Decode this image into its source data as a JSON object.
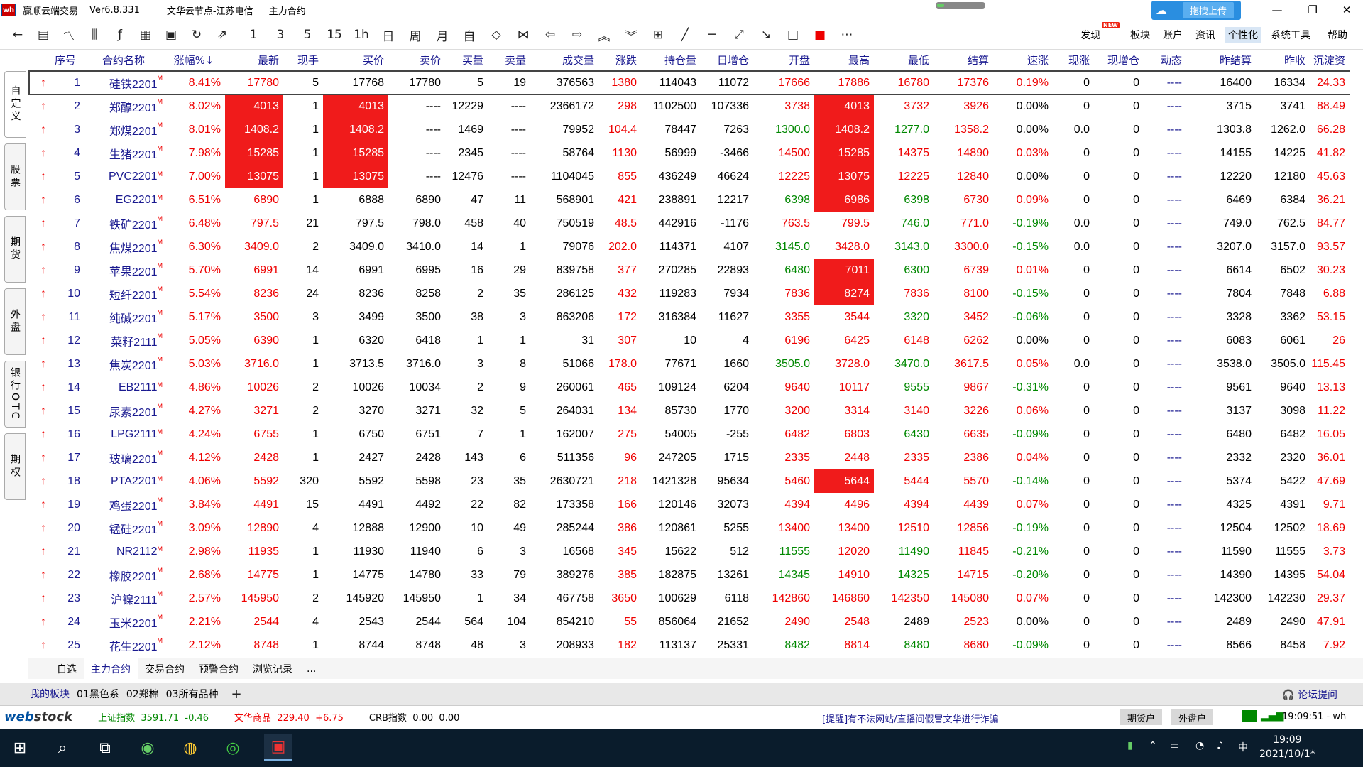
{
  "title": {
    "app": "赢顺云端交易",
    "version": "Ver6.8.331",
    "node": "文华云节点-江苏电信",
    "contract": "主力合约"
  },
  "cloud_upload": "拖拽上传",
  "menu": [
    {
      "label": "发现",
      "new": "NEW"
    },
    {
      "label": "板块"
    },
    {
      "label": "账户"
    },
    {
      "label": "资讯"
    },
    {
      "label": "个性化"
    },
    {
      "label": "系统工具"
    },
    {
      "label": "帮助"
    }
  ],
  "toolbar_periods": [
    "1",
    "3",
    "5",
    "15",
    "1h",
    "日",
    "周",
    "月",
    "自"
  ],
  "side_tabs": [
    "自定义",
    "股票",
    "期货",
    "外盘",
    "银行OTC",
    "期权"
  ],
  "columns": [
    "序号",
    "合约名称",
    "涨幅%↓",
    "最新",
    "现手",
    "买价",
    "卖价",
    "买量",
    "卖量",
    "成交量",
    "涨跌",
    "持仓量",
    "日增仓",
    "开盘",
    "最高",
    "最低",
    "结算",
    "速涨",
    "现涨",
    "现增仓",
    "动态",
    "昨结算",
    "昨收",
    "沉淀资"
  ],
  "rows": [
    [
      "1",
      "硅铁2201",
      "8.41%",
      "17780",
      "5",
      "17768",
      "17780",
      "5",
      "19",
      "376563",
      "1380",
      "114043",
      "11072",
      "17666",
      "17886",
      "16780",
      "17376",
      "0.19%",
      "0",
      "0",
      "----",
      "16400",
      "16334",
      "24.33"
    ],
    [
      "2",
      "郑醇2201",
      "8.02%",
      "4013",
      "1",
      "4013",
      "----",
      "12229",
      "----",
      "2366172",
      "298",
      "1102500",
      "107336",
      "3738",
      "4013",
      "3732",
      "3926",
      "0.00%",
      "0",
      "0",
      "----",
      "3715",
      "3741",
      "88.49"
    ],
    [
      "3",
      "郑煤2201",
      "8.01%",
      "1408.2",
      "1",
      "1408.2",
      "----",
      "1469",
      "----",
      "79952",
      "104.4",
      "78447",
      "7263",
      "1300.0",
      "1408.2",
      "1277.0",
      "1358.2",
      "0.00%",
      "0.0",
      "0",
      "----",
      "1303.8",
      "1262.0",
      "66.28"
    ],
    [
      "4",
      "生猪2201",
      "7.98%",
      "15285",
      "1",
      "15285",
      "----",
      "2345",
      "----",
      "58764",
      "1130",
      "56999",
      "-3466",
      "14500",
      "15285",
      "14375",
      "14890",
      "0.03%",
      "0",
      "0",
      "----",
      "14155",
      "14225",
      "41.82"
    ],
    [
      "5",
      "PVC2201",
      "7.00%",
      "13075",
      "1",
      "13075",
      "----",
      "12476",
      "----",
      "1104045",
      "855",
      "436249",
      "46624",
      "12225",
      "13075",
      "12225",
      "12840",
      "0.00%",
      "0",
      "0",
      "----",
      "12220",
      "12180",
      "45.63"
    ],
    [
      "6",
      "EG2201",
      "6.51%",
      "6890",
      "1",
      "6888",
      "6890",
      "47",
      "11",
      "568901",
      "421",
      "238891",
      "12217",
      "6398",
      "6986",
      "6398",
      "6730",
      "0.09%",
      "0",
      "0",
      "----",
      "6469",
      "6384",
      "36.21"
    ],
    [
      "7",
      "铁矿2201",
      "6.48%",
      "797.5",
      "21",
      "797.5",
      "798.0",
      "458",
      "40",
      "750519",
      "48.5",
      "442916",
      "-1176",
      "763.5",
      "799.5",
      "746.0",
      "771.0",
      "-0.19%",
      "0.0",
      "0",
      "----",
      "749.0",
      "762.5",
      "84.77"
    ],
    [
      "8",
      "焦煤2201",
      "6.30%",
      "3409.0",
      "2",
      "3409.0",
      "3410.0",
      "14",
      "1",
      "79076",
      "202.0",
      "114371",
      "4107",
      "3145.0",
      "3428.0",
      "3143.0",
      "3300.0",
      "-0.15%",
      "0.0",
      "0",
      "----",
      "3207.0",
      "3157.0",
      "93.57"
    ],
    [
      "9",
      "苹果2201",
      "5.70%",
      "6991",
      "14",
      "6991",
      "6995",
      "16",
      "29",
      "839758",
      "377",
      "270285",
      "22893",
      "6480",
      "7011",
      "6300",
      "6739",
      "0.01%",
      "0",
      "0",
      "----",
      "6614",
      "6502",
      "30.23"
    ],
    [
      "10",
      "短纤2201",
      "5.54%",
      "8236",
      "24",
      "8236",
      "8258",
      "2",
      "35",
      "286125",
      "432",
      "119283",
      "7934",
      "7836",
      "8274",
      "7836",
      "8100",
      "-0.15%",
      "0",
      "0",
      "----",
      "7804",
      "7848",
      "6.88"
    ],
    [
      "11",
      "纯碱2201",
      "5.17%",
      "3500",
      "3",
      "3499",
      "3500",
      "38",
      "3",
      "863206",
      "172",
      "316384",
      "11627",
      "3355",
      "3544",
      "3320",
      "3452",
      "-0.06%",
      "0",
      "0",
      "----",
      "3328",
      "3362",
      "53.15"
    ],
    [
      "12",
      "菜籽2111",
      "5.05%",
      "6390",
      "1",
      "6320",
      "6418",
      "1",
      "1",
      "31",
      "307",
      "10",
      "4",
      "6196",
      "6425",
      "6148",
      "6262",
      "0.00%",
      "0",
      "0",
      "----",
      "6083",
      "6061",
      "26"
    ],
    [
      "13",
      "焦炭2201",
      "5.03%",
      "3716.0",
      "1",
      "3713.5",
      "3716.0",
      "3",
      "8",
      "51066",
      "178.0",
      "77671",
      "1660",
      "3505.0",
      "3728.0",
      "3470.0",
      "3617.5",
      "0.05%",
      "0.0",
      "0",
      "----",
      "3538.0",
      "3505.0",
      "115.45"
    ],
    [
      "14",
      "EB2111",
      "4.86%",
      "10026",
      "2",
      "10026",
      "10034",
      "2",
      "9",
      "260061",
      "465",
      "109124",
      "6204",
      "9640",
      "10117",
      "9555",
      "9867",
      "-0.31%",
      "0",
      "0",
      "----",
      "9561",
      "9640",
      "13.13"
    ],
    [
      "15",
      "尿素2201",
      "4.27%",
      "3271",
      "2",
      "3270",
      "3271",
      "32",
      "5",
      "264031",
      "134",
      "85730",
      "1770",
      "3200",
      "3314",
      "3140",
      "3226",
      "0.06%",
      "0",
      "0",
      "----",
      "3137",
      "3098",
      "11.22"
    ],
    [
      "16",
      "LPG2111",
      "4.24%",
      "6755",
      "1",
      "6750",
      "6751",
      "7",
      "1",
      "162007",
      "275",
      "54005",
      "-255",
      "6482",
      "6803",
      "6430",
      "6635",
      "-0.09%",
      "0",
      "0",
      "----",
      "6480",
      "6482",
      "16.05"
    ],
    [
      "17",
      "玻璃2201",
      "4.12%",
      "2428",
      "1",
      "2427",
      "2428",
      "143",
      "6",
      "511356",
      "96",
      "247205",
      "1715",
      "2335",
      "2448",
      "2335",
      "2386",
      "0.04%",
      "0",
      "0",
      "----",
      "2332",
      "2320",
      "36.01"
    ],
    [
      "18",
      "PTA2201",
      "4.06%",
      "5592",
      "320",
      "5592",
      "5598",
      "23",
      "35",
      "2630721",
      "218",
      "1421328",
      "95634",
      "5460",
      "5644",
      "5444",
      "5570",
      "-0.14%",
      "0",
      "0",
      "----",
      "5374",
      "5422",
      "47.69"
    ],
    [
      "19",
      "鸡蛋2201",
      "3.84%",
      "4491",
      "15",
      "4491",
      "4492",
      "22",
      "82",
      "173358",
      "166",
      "120146",
      "32073",
      "4394",
      "4496",
      "4394",
      "4439",
      "0.07%",
      "0",
      "0",
      "----",
      "4325",
      "4391",
      "9.71"
    ],
    [
      "20",
      "锰硅2201",
      "3.09%",
      "12890",
      "4",
      "12888",
      "12900",
      "10",
      "49",
      "285244",
      "386",
      "120861",
      "5255",
      "13400",
      "13400",
      "12510",
      "12856",
      "-0.19%",
      "0",
      "0",
      "----",
      "12504",
      "12502",
      "18.69"
    ],
    [
      "21",
      "NR2112",
      "2.98%",
      "11935",
      "1",
      "11930",
      "11940",
      "6",
      "3",
      "16568",
      "345",
      "15622",
      "512",
      "11555",
      "12020",
      "11490",
      "11845",
      "-0.21%",
      "0",
      "0",
      "----",
      "11590",
      "11555",
      "3.73"
    ],
    [
      "22",
      "橡胶2201",
      "2.68%",
      "14775",
      "1",
      "14775",
      "14780",
      "33",
      "79",
      "389276",
      "385",
      "182875",
      "13261",
      "14345",
      "14910",
      "14325",
      "14715",
      "-0.20%",
      "0",
      "0",
      "----",
      "14390",
      "14395",
      "54.04"
    ],
    [
      "23",
      "沪镍2111",
      "2.57%",
      "145950",
      "2",
      "145920",
      "145950",
      "1",
      "34",
      "467758",
      "3650",
      "100629",
      "6118",
      "142860",
      "146860",
      "142350",
      "145080",
      "0.07%",
      "0",
      "0",
      "----",
      "142300",
      "142230",
      "29.37"
    ],
    [
      "24",
      "玉米2201",
      "2.21%",
      "2544",
      "4",
      "2543",
      "2544",
      "564",
      "104",
      "854210",
      "55",
      "856064",
      "21652",
      "2490",
      "2548",
      "2489",
      "2523",
      "0.00%",
      "0",
      "0",
      "----",
      "2489",
      "2490",
      "47.91"
    ],
    [
      "25",
      "花生2201",
      "2.12%",
      "8748",
      "1",
      "8744",
      "8748",
      "48",
      "3",
      "208933",
      "182",
      "113137",
      "25331",
      "8482",
      "8814",
      "8480",
      "8680",
      "-0.09%",
      "0",
      "0",
      "----",
      "8566",
      "8458",
      "7.92"
    ]
  ],
  "contract_badge": "M",
  "bottom_tabs": [
    "自选",
    "主力合约",
    "交易合约",
    "预警合约",
    "浏览记录",
    "..."
  ],
  "plates": [
    "我的板块",
    "01黑色系",
    "02郑棉",
    "03所有品种"
  ],
  "forum_help": "论坛提问",
  "status": {
    "logo_a": "web",
    "logo_b": "stock",
    "sh_label": "上证指数",
    "sh_value": "3591.71",
    "sh_change": "-0.46",
    "wh_label": "文华商品",
    "wh_value": "229.40",
    "wh_change": "+6.75",
    "crb_label": "CRB指数",
    "crb_value": "0.00",
    "crb_change": "0.00",
    "warning": "[提醒]有不法网站/直播间假冒文华进行诈骗",
    "acct1": "期货户",
    "acct2": "外盘户",
    "time": "19:09:51 - wh"
  },
  "taskbar": {
    "time": "19:09",
    "date": "2021/10/1*"
  },
  "colors": {
    "up": "#e00000",
    "down": "#008000",
    "highlight": "#f01b1b",
    "header_text": "#1a1a90"
  }
}
